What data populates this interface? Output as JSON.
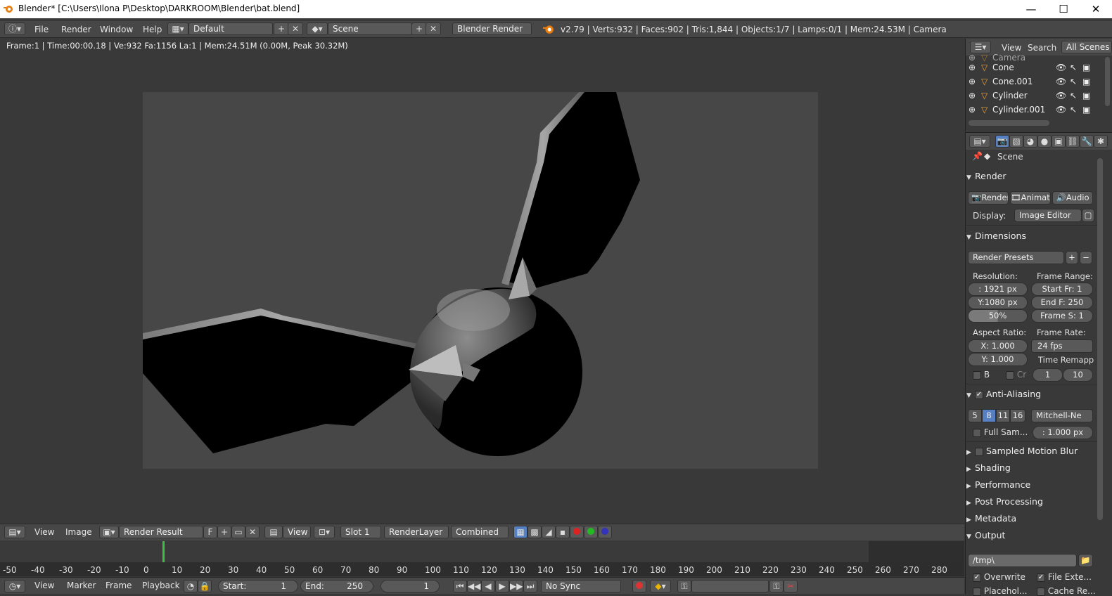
{
  "window": {
    "title": "Blender* [C:\\Users\\Ilona P\\Desktop\\DARKROOM\\Blender\\bat.blend]",
    "minimize": "—",
    "maximize": "☐",
    "close": "✕"
  },
  "topbar": {
    "menus": [
      "File",
      "Render",
      "Window",
      "Help"
    ],
    "layout": "Default",
    "scene": "Scene",
    "engine": "Blender Render",
    "stats": "v2.79 | Verts:932 | Faces:902 | Tris:1,844 | Objects:1/7 | Lamps:0/1 | Mem:24.53M | Camera"
  },
  "image_editor": {
    "info": "Frame:1 | Time:00:00.18 | Ve:932 Fa:1156 La:1 | Mem:24.51M (0.00M, Peak 30.32M)"
  },
  "image_header": {
    "view": "View",
    "image": "Image",
    "image_name": "Render Result",
    "fake_user": "F",
    "view2": "View",
    "slot": "Slot 1",
    "layer": "RenderLayer",
    "pass": "Combined"
  },
  "timeline": {
    "ticks": [
      "-50",
      "-40",
      "-30",
      "-20",
      "-10",
      "0",
      "10",
      "20",
      "30",
      "40",
      "50",
      "60",
      "70",
      "80",
      "90",
      "100",
      "110",
      "120",
      "130",
      "140",
      "150",
      "160",
      "170",
      "180",
      "190",
      "200",
      "210",
      "220",
      "230",
      "240",
      "250",
      "260",
      "270",
      "280"
    ],
    "current_frame": 1
  },
  "timeline_header": {
    "view": "View",
    "marker": "Marker",
    "frame": "Frame",
    "playback": "Playback",
    "start_label": "Start:",
    "start": "1",
    "end_label": "End:",
    "end": "250",
    "current": "1",
    "sync": "No Sync"
  },
  "outliner": {
    "view": "View",
    "search": "Search",
    "filter": "All Scenes",
    "items": [
      "Camera",
      "Cone",
      "Cone.001",
      "Cylinder",
      "Cylinder.001"
    ]
  },
  "properties": {
    "context": "Scene",
    "render_panel": "Render",
    "render_btn": "Render",
    "anim_btn": "Animati",
    "audio_btn": "Audio",
    "display_label": "Display:",
    "display_value": "Image Editor",
    "dimensions_panel": "Dimensions",
    "presets": "Render Presets",
    "resolution_label": "Resolution:",
    "res_x": ": 1921 px",
    "res_y": "Y:1080 px",
    "res_pct": "50%",
    "frame_range_label": "Frame Range:",
    "start_fr": "Start Fr: 1",
    "end_f": "End F: 250",
    "frame_s": "Frame S: 1",
    "aspect_label": "Aspect Ratio:",
    "aspect_x": "X:   1.000",
    "aspect_y": "Y:   1.000",
    "frame_rate_label": "Frame Rate:",
    "fps": "24 fps",
    "time_remap_label": "Time Remapp",
    "remap_old": "1",
    "remap_new": "10",
    "border_b": "B",
    "border_cr": "Cr",
    "aa_panel": "Anti-Aliasing",
    "aa_samples": [
      "5",
      "8",
      "11",
      "16"
    ],
    "aa_filter": "Mitchell-Ne",
    "full_sample": "Full Sam...",
    "filter_size": ": 1.000 px",
    "collapsed": [
      "Sampled Motion Blur",
      "Shading",
      "Performance",
      "Post Processing",
      "Metadata"
    ],
    "output_panel": "Output",
    "output_path": "/tmp\\",
    "overwrite": "Overwrite",
    "file_ext": "File Exte...",
    "placeholders": "Placehol...",
    "cache_result": "Cache Re..."
  },
  "colors": {
    "accent": "#5680c2",
    "render_bg": "#474747",
    "panel_bg": "#393939"
  }
}
